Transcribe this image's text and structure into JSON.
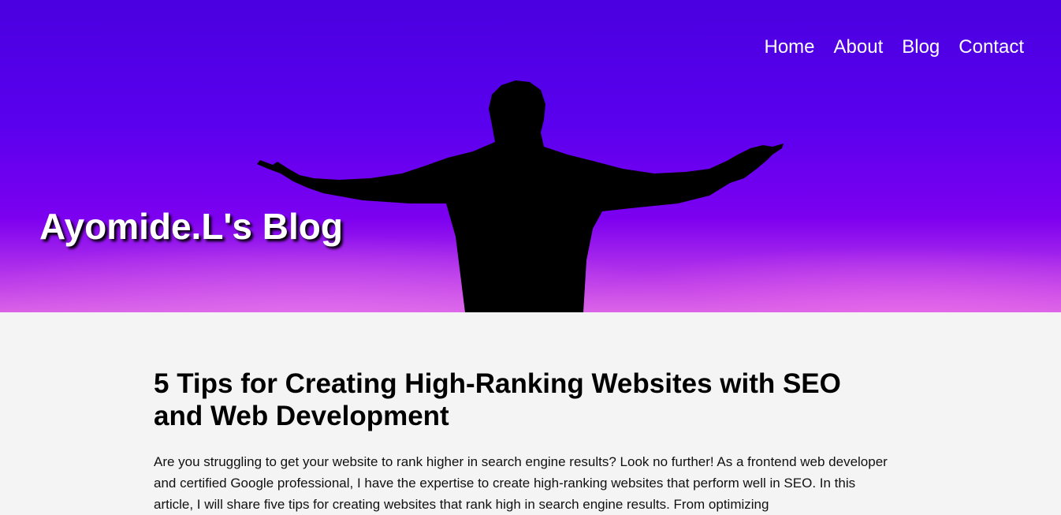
{
  "header": {
    "site_title": "Ayomide.L's Blog",
    "nav": [
      {
        "label": "Home"
      },
      {
        "label": "About"
      },
      {
        "label": "Blog"
      },
      {
        "label": "Contact"
      }
    ],
    "colors": {
      "hero_top": "#4a00e0",
      "hero_bottom": "#d860e6",
      "silhouette": "#000000"
    }
  },
  "article": {
    "title": "5 Tips for Creating High-Ranking Websites with SEO and Web Development",
    "intro": "Are you struggling to get your website to rank higher in search engine results? Look no further! As a frontend web developer and certified Google professional, I have the expertise to create high-ranking websites that perform well in SEO. In this article, I will share five tips for creating websites that rank high in search engine results. From optimizing"
  }
}
